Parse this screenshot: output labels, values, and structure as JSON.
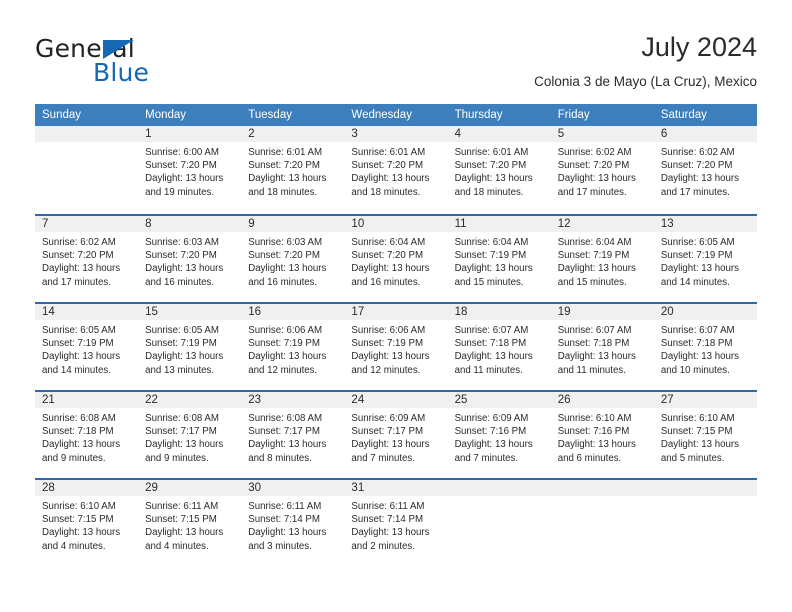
{
  "brand": {
    "name_part1": "General",
    "name_part2": "Blue",
    "triangle_color": "#1668b3"
  },
  "header": {
    "title": "July 2024",
    "subtitle": "Colonia 3 de Mayo (La Cruz), Mexico"
  },
  "colors": {
    "header_row_bg": "#3d7ebd",
    "week_separator": "#2f6aa8",
    "daynum_band_bg": "#f0f0f0",
    "text": "#2b2b2b",
    "brand_blue": "#1668b3"
  },
  "weekdays": [
    "Sunday",
    "Monday",
    "Tuesday",
    "Wednesday",
    "Thursday",
    "Friday",
    "Saturday"
  ],
  "weeks": [
    [
      {
        "day": "",
        "sunrise": "",
        "sunset": "",
        "daylight_line1": "",
        "daylight_line2": "",
        "empty": true
      },
      {
        "day": "1",
        "sunrise": "Sunrise: 6:00 AM",
        "sunset": "Sunset: 7:20 PM",
        "daylight_line1": "Daylight: 13 hours",
        "daylight_line2": "and 19 minutes."
      },
      {
        "day": "2",
        "sunrise": "Sunrise: 6:01 AM",
        "sunset": "Sunset: 7:20 PM",
        "daylight_line1": "Daylight: 13 hours",
        "daylight_line2": "and 18 minutes."
      },
      {
        "day": "3",
        "sunrise": "Sunrise: 6:01 AM",
        "sunset": "Sunset: 7:20 PM",
        "daylight_line1": "Daylight: 13 hours",
        "daylight_line2": "and 18 minutes."
      },
      {
        "day": "4",
        "sunrise": "Sunrise: 6:01 AM",
        "sunset": "Sunset: 7:20 PM",
        "daylight_line1": "Daylight: 13 hours",
        "daylight_line2": "and 18 minutes."
      },
      {
        "day": "5",
        "sunrise": "Sunrise: 6:02 AM",
        "sunset": "Sunset: 7:20 PM",
        "daylight_line1": "Daylight: 13 hours",
        "daylight_line2": "and 17 minutes."
      },
      {
        "day": "6",
        "sunrise": "Sunrise: 6:02 AM",
        "sunset": "Sunset: 7:20 PM",
        "daylight_line1": "Daylight: 13 hours",
        "daylight_line2": "and 17 minutes."
      }
    ],
    [
      {
        "day": "7",
        "sunrise": "Sunrise: 6:02 AM",
        "sunset": "Sunset: 7:20 PM",
        "daylight_line1": "Daylight: 13 hours",
        "daylight_line2": "and 17 minutes."
      },
      {
        "day": "8",
        "sunrise": "Sunrise: 6:03 AM",
        "sunset": "Sunset: 7:20 PM",
        "daylight_line1": "Daylight: 13 hours",
        "daylight_line2": "and 16 minutes."
      },
      {
        "day": "9",
        "sunrise": "Sunrise: 6:03 AM",
        "sunset": "Sunset: 7:20 PM",
        "daylight_line1": "Daylight: 13 hours",
        "daylight_line2": "and 16 minutes."
      },
      {
        "day": "10",
        "sunrise": "Sunrise: 6:04 AM",
        "sunset": "Sunset: 7:20 PM",
        "daylight_line1": "Daylight: 13 hours",
        "daylight_line2": "and 16 minutes."
      },
      {
        "day": "11",
        "sunrise": "Sunrise: 6:04 AM",
        "sunset": "Sunset: 7:19 PM",
        "daylight_line1": "Daylight: 13 hours",
        "daylight_line2": "and 15 minutes."
      },
      {
        "day": "12",
        "sunrise": "Sunrise: 6:04 AM",
        "sunset": "Sunset: 7:19 PM",
        "daylight_line1": "Daylight: 13 hours",
        "daylight_line2": "and 15 minutes."
      },
      {
        "day": "13",
        "sunrise": "Sunrise: 6:05 AM",
        "sunset": "Sunset: 7:19 PM",
        "daylight_line1": "Daylight: 13 hours",
        "daylight_line2": "and 14 minutes."
      }
    ],
    [
      {
        "day": "14",
        "sunrise": "Sunrise: 6:05 AM",
        "sunset": "Sunset: 7:19 PM",
        "daylight_line1": "Daylight: 13 hours",
        "daylight_line2": "and 14 minutes."
      },
      {
        "day": "15",
        "sunrise": "Sunrise: 6:05 AM",
        "sunset": "Sunset: 7:19 PM",
        "daylight_line1": "Daylight: 13 hours",
        "daylight_line2": "and 13 minutes."
      },
      {
        "day": "16",
        "sunrise": "Sunrise: 6:06 AM",
        "sunset": "Sunset: 7:19 PM",
        "daylight_line1": "Daylight: 13 hours",
        "daylight_line2": "and 12 minutes."
      },
      {
        "day": "17",
        "sunrise": "Sunrise: 6:06 AM",
        "sunset": "Sunset: 7:19 PM",
        "daylight_line1": "Daylight: 13 hours",
        "daylight_line2": "and 12 minutes."
      },
      {
        "day": "18",
        "sunrise": "Sunrise: 6:07 AM",
        "sunset": "Sunset: 7:18 PM",
        "daylight_line1": "Daylight: 13 hours",
        "daylight_line2": "and 11 minutes."
      },
      {
        "day": "19",
        "sunrise": "Sunrise: 6:07 AM",
        "sunset": "Sunset: 7:18 PM",
        "daylight_line1": "Daylight: 13 hours",
        "daylight_line2": "and 11 minutes."
      },
      {
        "day": "20",
        "sunrise": "Sunrise: 6:07 AM",
        "sunset": "Sunset: 7:18 PM",
        "daylight_line1": "Daylight: 13 hours",
        "daylight_line2": "and 10 minutes."
      }
    ],
    [
      {
        "day": "21",
        "sunrise": "Sunrise: 6:08 AM",
        "sunset": "Sunset: 7:18 PM",
        "daylight_line1": "Daylight: 13 hours",
        "daylight_line2": "and 9 minutes."
      },
      {
        "day": "22",
        "sunrise": "Sunrise: 6:08 AM",
        "sunset": "Sunset: 7:17 PM",
        "daylight_line1": "Daylight: 13 hours",
        "daylight_line2": "and 9 minutes."
      },
      {
        "day": "23",
        "sunrise": "Sunrise: 6:08 AM",
        "sunset": "Sunset: 7:17 PM",
        "daylight_line1": "Daylight: 13 hours",
        "daylight_line2": "and 8 minutes."
      },
      {
        "day": "24",
        "sunrise": "Sunrise: 6:09 AM",
        "sunset": "Sunset: 7:17 PM",
        "daylight_line1": "Daylight: 13 hours",
        "daylight_line2": "and 7 minutes."
      },
      {
        "day": "25",
        "sunrise": "Sunrise: 6:09 AM",
        "sunset": "Sunset: 7:16 PM",
        "daylight_line1": "Daylight: 13 hours",
        "daylight_line2": "and 7 minutes."
      },
      {
        "day": "26",
        "sunrise": "Sunrise: 6:10 AM",
        "sunset": "Sunset: 7:16 PM",
        "daylight_line1": "Daylight: 13 hours",
        "daylight_line2": "and 6 minutes."
      },
      {
        "day": "27",
        "sunrise": "Sunrise: 6:10 AM",
        "sunset": "Sunset: 7:15 PM",
        "daylight_line1": "Daylight: 13 hours",
        "daylight_line2": "and 5 minutes."
      }
    ],
    [
      {
        "day": "28",
        "sunrise": "Sunrise: 6:10 AM",
        "sunset": "Sunset: 7:15 PM",
        "daylight_line1": "Daylight: 13 hours",
        "daylight_line2": "and 4 minutes."
      },
      {
        "day": "29",
        "sunrise": "Sunrise: 6:11 AM",
        "sunset": "Sunset: 7:15 PM",
        "daylight_line1": "Daylight: 13 hours",
        "daylight_line2": "and 4 minutes."
      },
      {
        "day": "30",
        "sunrise": "Sunrise: 6:11 AM",
        "sunset": "Sunset: 7:14 PM",
        "daylight_line1": "Daylight: 13 hours",
        "daylight_line2": "and 3 minutes."
      },
      {
        "day": "31",
        "sunrise": "Sunrise: 6:11 AM",
        "sunset": "Sunset: 7:14 PM",
        "daylight_line1": "Daylight: 13 hours",
        "daylight_line2": "and 2 minutes."
      },
      {
        "day": "",
        "sunrise": "",
        "sunset": "",
        "daylight_line1": "",
        "daylight_line2": "",
        "empty": true
      },
      {
        "day": "",
        "sunrise": "",
        "sunset": "",
        "daylight_line1": "",
        "daylight_line2": "",
        "empty": true
      },
      {
        "day": "",
        "sunrise": "",
        "sunset": "",
        "daylight_line1": "",
        "daylight_line2": "",
        "empty": true
      }
    ]
  ]
}
